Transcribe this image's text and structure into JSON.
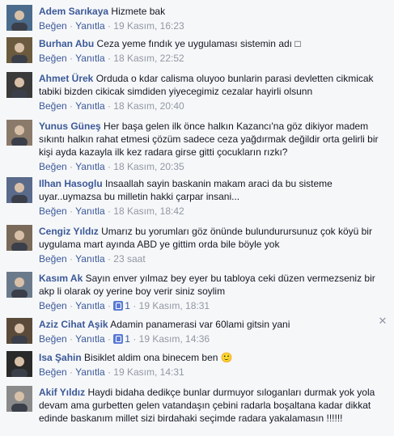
{
  "labels": {
    "like": "Beğen",
    "reply": "Yanıtla",
    "sep": "·"
  },
  "colors": {
    "link": "#3b5998",
    "meta": "#9197a3",
    "background": "#f6f7f9"
  },
  "comments": [
    {
      "name": "Adem Sarıkaya",
      "text": "Hizmete bak",
      "time": "19 Kasım, 16:23",
      "likes": "",
      "avatar": "#4a6b8c"
    },
    {
      "name": "Burhan Abu",
      "text": "Ceza yeme fındık ye uygulaması sistemin adı □",
      "time": "18 Kasım, 22:52",
      "likes": "",
      "avatar": "#6b5a3e"
    },
    {
      "name": "Ahmet Ürek",
      "text": "Orduda o kdar calisma oluyoo bunlarin parasi devletten cikmicak tabiki bizden cikicak simdiden yiyecegimiz cezalar hayirli olsunn",
      "time": "18 Kasım, 20:40",
      "likes": "",
      "avatar": "#3a3a3a"
    },
    {
      "name": "Yunus Güneş",
      "text": "Her başa gelen ilk önce halkın Kazancı'na göz dikiyor madem sıkıntı halkın rahat etmesi çözüm sadece ceza yağdırmak değildir orta gelirli bir kişi ayda kazayla ilk kez radara girse gitti çocukların rızkı?",
      "time": "18 Kasım, 20:35",
      "likes": "",
      "avatar": "#8a7a6a"
    },
    {
      "name": "Ilhan Hasoglu",
      "text": "Insaallah sayin baskanin makam araci da bu sisteme uyar..uymazsa bu milletin hakki çarpar insani...",
      "time": "18 Kasım, 18:42",
      "likes": "",
      "avatar": "#5a6a8a"
    },
    {
      "name": "Cengiz Yıldız",
      "text": "Umarız bu yorumları göz önünde bulundurursunuz çok köyü bir uygulama mart ayında ABD ye gittim orda bile böyle yok",
      "time": "23 saat",
      "likes": "",
      "avatar": "#7a6a5a"
    },
    {
      "name": "Kasım Ak",
      "text": "Sayın enver yılmaz bey eyer bu tabloya ceki düzen vermezseniz bir akp li olarak oy yerine boy verir siniz soylim",
      "time": "19 Kasım, 18:31",
      "likes": "1",
      "avatar": "#6a7a8a"
    },
    {
      "name": "Aziz Cihat Aşik",
      "text": "Adamin panamerasi var 60lami gitsin yani",
      "time": "19 Kasım, 14:36",
      "likes": "1",
      "avatar": "#5a4a3a"
    },
    {
      "name": "Isa Şahin",
      "text": "Bisiklet aldim ona binecem ben 🙂",
      "time": "19 Kasım, 14:31",
      "likes": "",
      "avatar": "#2a2a2a"
    },
    {
      "name": "Akif Yıldız",
      "text": "Haydi bidaha dedikçe bunlar durmuyor sıloganları durmak yok yola devam ama gurbetten gelen vatandaşın çebini radarla boşaltana kadar dikkat edinde baskanım millet sizi birdahaki seçimde radara yakalamasın !!!!!!",
      "time": "",
      "likes": "",
      "avatar": "#8a8a8a"
    }
  ]
}
